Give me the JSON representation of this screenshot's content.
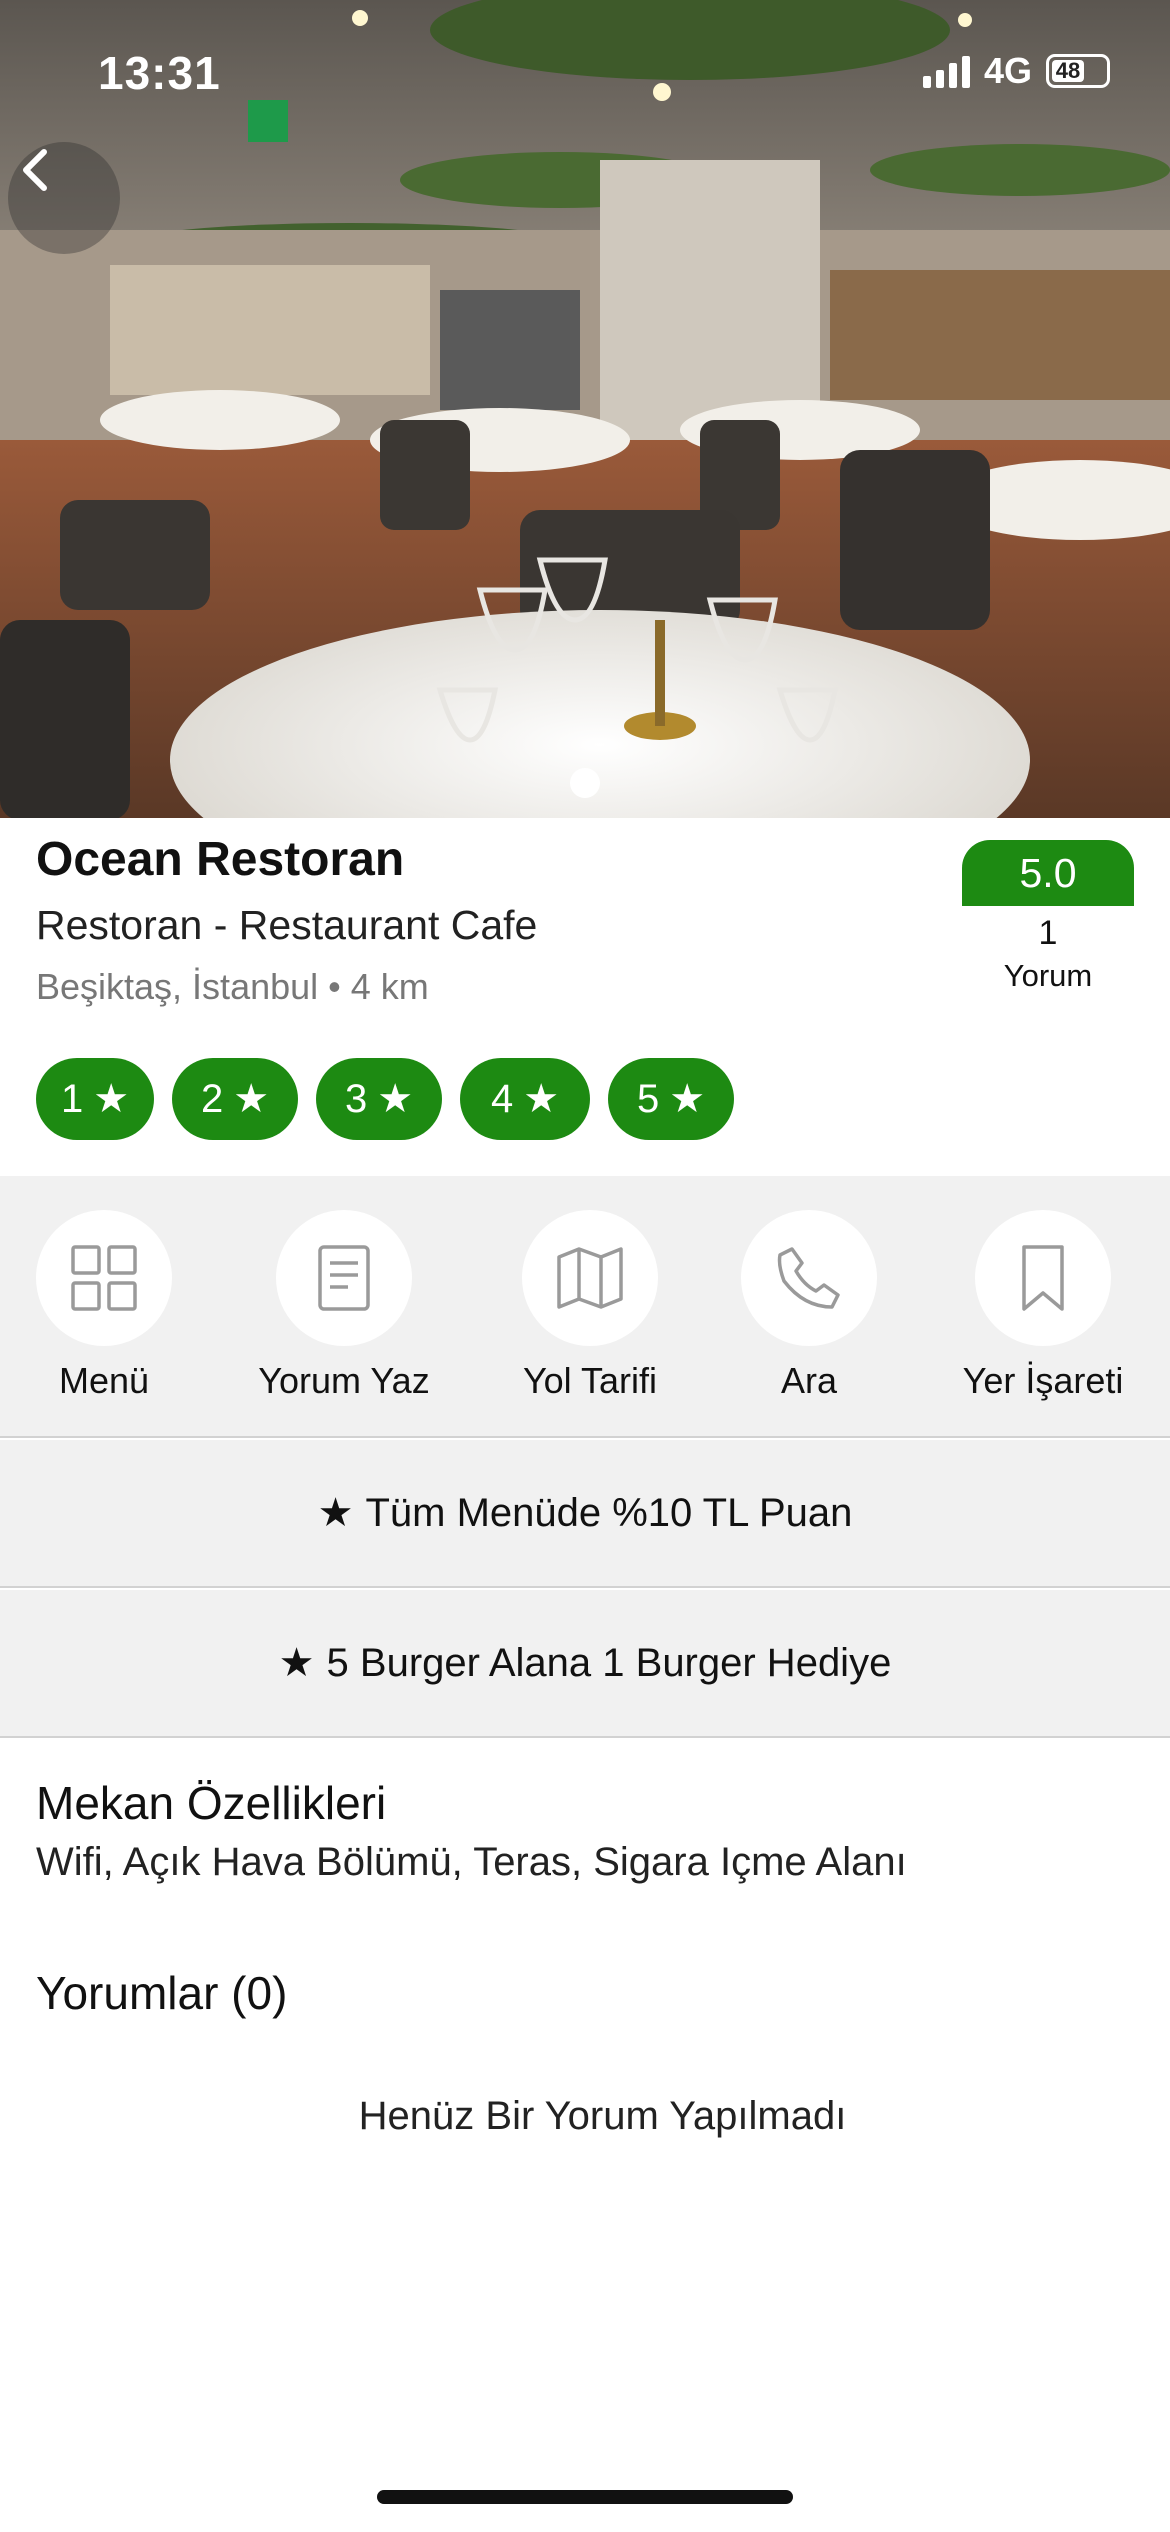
{
  "status_bar": {
    "time": "13:31",
    "network": "4G",
    "battery": "48"
  },
  "restaurant": {
    "name": "Ocean Restoran",
    "category": "Restoran - Restaurant Cafe",
    "location": "Beşiktaş, İstanbul • 4 km",
    "rating": "5.0",
    "review_count": "1",
    "review_label": "Yorum",
    "gallery": {
      "total_images": 1,
      "current_index": 1
    }
  },
  "rating_filters": [
    {
      "label": "1",
      "star": "★"
    },
    {
      "label": "2",
      "star": "★"
    },
    {
      "label": "3",
      "star": "★"
    },
    {
      "label": "4",
      "star": "★"
    },
    {
      "label": "5",
      "star": "★"
    }
  ],
  "actions": [
    {
      "label": "Menü",
      "icon": "grid-icon"
    },
    {
      "label": "Yorum Yaz",
      "icon": "document-icon"
    },
    {
      "label": "Yol Tarifi",
      "icon": "map-icon"
    },
    {
      "label": "Ara",
      "icon": "phone-icon"
    },
    {
      "label": "Yer İşareti",
      "icon": "bookmark-icon"
    }
  ],
  "promotions": [
    {
      "star": "★",
      "text": "Tüm Menüde %10 TL Puan"
    },
    {
      "star": "★",
      "text": "5 Burger Alana 1 Burger Hediye"
    }
  ],
  "features": {
    "title": "Mekan Özellikleri",
    "text": "Wifi, Açık Hava Bölümü, Teras, Sigara Içme Alanı"
  },
  "reviews": {
    "title": "Yorumlar (0)",
    "empty_text": "Henüz Bir Yorum Yapılmadı"
  },
  "colors": {
    "accent_green": "#1d8a12",
    "action_bar_bg": "#f1f1f1",
    "muted_text": "#777777"
  }
}
